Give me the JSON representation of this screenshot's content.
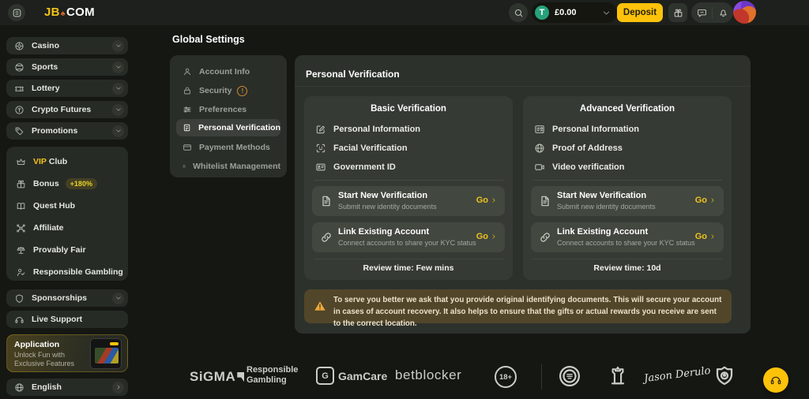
{
  "topbar": {
    "logo": {
      "part1": "JB",
      "part2": "COM"
    },
    "balance": {
      "amount": "£0.00",
      "currency": "tether"
    },
    "deposit_label": "Deposit"
  },
  "icons": {
    "menu": "menu",
    "search": "search",
    "tether_symbol": "T",
    "balance_chevron": "chevdown",
    "gift": "gift",
    "chat": "chat",
    "notifications": "bell",
    "language_chevron": "chevright",
    "notice_warning": "warning",
    "support": "headset"
  },
  "sidebar": {
    "primary": [
      {
        "label": "Casino",
        "icon": "chip"
      },
      {
        "label": "Sports",
        "icon": "ball"
      },
      {
        "label": "Lottery",
        "icon": "ticket"
      },
      {
        "label": "Crypto Futures",
        "icon": "coin"
      },
      {
        "label": "Promotions",
        "icon": "tag"
      }
    ],
    "secondary": [
      {
        "label_accent": "VIP",
        "label": "Club",
        "icon": "crown"
      },
      {
        "label": "Bonus",
        "icon": "gift",
        "badge": "+180%"
      },
      {
        "label": "Quest Hub",
        "icon": "book"
      },
      {
        "label": "Affiliate",
        "icon": "network"
      },
      {
        "label": "Provably Fair",
        "icon": "scale"
      },
      {
        "label": "Responsible Gambling",
        "icon": "care"
      }
    ],
    "tertiary": [
      {
        "label": "Sponsorships",
        "icon": "shield"
      },
      {
        "label": "Live Support",
        "icon": "headset"
      }
    ],
    "app_card": {
      "title": "Application",
      "line1": "Unlock Fun with",
      "line2": "Exclusive Features"
    },
    "language": {
      "label": "English",
      "icon": "globe"
    }
  },
  "settings": {
    "title": "Global Settings",
    "items": [
      {
        "label": "Account Info",
        "icon": "user"
      },
      {
        "label": "Security",
        "icon": "lock",
        "warning": true
      },
      {
        "label": "Preferences",
        "icon": "sliders"
      },
      {
        "label": "Personal Verification",
        "icon": "docverify",
        "active": true
      },
      {
        "label": "Payment Methods",
        "icon": "card"
      },
      {
        "label": "Whitelist Management",
        "icon": "list"
      }
    ]
  },
  "main": {
    "title": "Personal Verification",
    "cards": [
      {
        "title": "Basic Verification",
        "features": [
          {
            "label": "Personal Information",
            "icon": "edit"
          },
          {
            "label": "Facial Verification",
            "icon": "face"
          },
          {
            "label": "Government ID",
            "icon": "idcard"
          }
        ],
        "actions": [
          {
            "title": "Start New Verification",
            "subtitle": "Submit new identity documents",
            "cta": "Go",
            "icon": "doc"
          },
          {
            "title": "Link Existing Account",
            "subtitle": "Connect accounts to share your KYC status",
            "cta": "Go",
            "icon": "link"
          }
        ],
        "review_time": "Review time: Few mins"
      },
      {
        "title": "Advanced Verification",
        "features": [
          {
            "label": "Personal Information",
            "icon": "form"
          },
          {
            "label": "Proof of Address",
            "icon": "globe"
          },
          {
            "label": "Video verification",
            "icon": "video"
          }
        ],
        "actions": [
          {
            "title": "Start New Verification",
            "subtitle": "Submit new identity documents",
            "cta": "Go",
            "icon": "doc"
          },
          {
            "title": "Link Existing Account",
            "subtitle": "Connect accounts to share your KYC status",
            "cta": "Go",
            "icon": "link"
          }
        ],
        "review_time": "Review time: 10d"
      }
    ],
    "notice": "To serve you better we ask that you provide original identifying documents. This will secure your account in cases of account recovery. It also helps to ensure that the gifts or actual rewards you receive are sent to the correct location."
  },
  "footer": {
    "sigma": "SiGMA",
    "rg_line1": "Responsible",
    "rg_line2": "Gambling",
    "gamcare_initial": "G",
    "gamcare": "GamCare",
    "betblocker": "betblocker",
    "age": "18+",
    "signature": "Jason Derulo"
  },
  "colors": {
    "accent": "#fdc20a",
    "tether_green": "#26a17b",
    "notice_bg": "#52462a",
    "panel_bg": "#2d312c"
  }
}
